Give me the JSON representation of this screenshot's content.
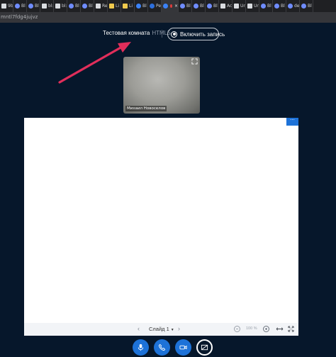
{
  "browser": {
    "tabs": [
      {
        "label": "9b",
        "favicon_color": "#d9dce0",
        "shape": "sq"
      },
      {
        "label": "Bl",
        "favicon_color": "#6f8cff",
        "shape": "circle"
      },
      {
        "label": "Bl",
        "favicon_color": "#6f8cff",
        "shape": "circle"
      },
      {
        "label": "bl:",
        "favicon_color": "#d9dce0",
        "shape": "sq"
      },
      {
        "label": "bl:",
        "favicon_color": "#d9dce0",
        "shape": "sq"
      },
      {
        "label": "Bl",
        "favicon_color": "#6f8cff",
        "shape": "circle"
      },
      {
        "label": "Bl",
        "favicon_color": "#6f8cff",
        "shape": "circle"
      },
      {
        "label": "Re",
        "favicon_color": "#d9dce0",
        "shape": "sq"
      },
      {
        "label": "Li",
        "favicon_color": "#f0c94d",
        "shape": "sq"
      },
      {
        "label": "Li",
        "favicon_color": "#f0c94d",
        "shape": "sq"
      },
      {
        "label": "Bl",
        "favicon_color": "#3b82f6",
        "shape": "circle"
      },
      {
        "label": "Pe",
        "favicon_color": "#2d6fdc",
        "shape": "circle"
      },
      {
        "label": "",
        "favicon_color": "#3b82f6",
        "shape": "circle",
        "active": true
      },
      {
        "label": "Bl",
        "favicon_color": "#6f8cff",
        "shape": "circle"
      },
      {
        "label": "Bl",
        "favicon_color": "#6f8cff",
        "shape": "circle"
      },
      {
        "label": "Bl",
        "favicon_color": "#6f8cff",
        "shape": "circle"
      },
      {
        "label": "Ac",
        "favicon_color": "#d9dce0",
        "shape": "sq"
      },
      {
        "label": "Ur",
        "favicon_color": "#d9dce0",
        "shape": "sq"
      },
      {
        "label": "Ur",
        "favicon_color": "#d9dce0",
        "shape": "sq"
      },
      {
        "label": "Bl",
        "favicon_color": "#6f8cff",
        "shape": "circle"
      },
      {
        "label": "Bl",
        "favicon_color": "#6f8cff",
        "shape": "circle"
      },
      {
        "label": "de",
        "favicon_color": "#6f8cff",
        "shape": "circle"
      },
      {
        "label": "Bl",
        "favicon_color": "#6f8cff",
        "shape": "circle"
      }
    ],
    "address": "mntl7fdg4jujvz"
  },
  "room": {
    "title": "Тестовая комната",
    "subtitle": "HTML5",
    "record_label": "Включить запись"
  },
  "webcam": {
    "name": "Михаил Новоселов"
  },
  "presentation": {
    "menu_glyph": "···",
    "prev_glyph": "‹",
    "next_glyph": "›",
    "slide_label": "Слайд 1",
    "zoom_label": "100 %"
  },
  "colors": {
    "background": "#06172b",
    "accent": "#1d72d8",
    "arrow": "#e02e5a"
  },
  "icons": {
    "controls": [
      "microphone-icon",
      "phone-icon",
      "video-camera-icon",
      "screen-share-icon"
    ]
  }
}
